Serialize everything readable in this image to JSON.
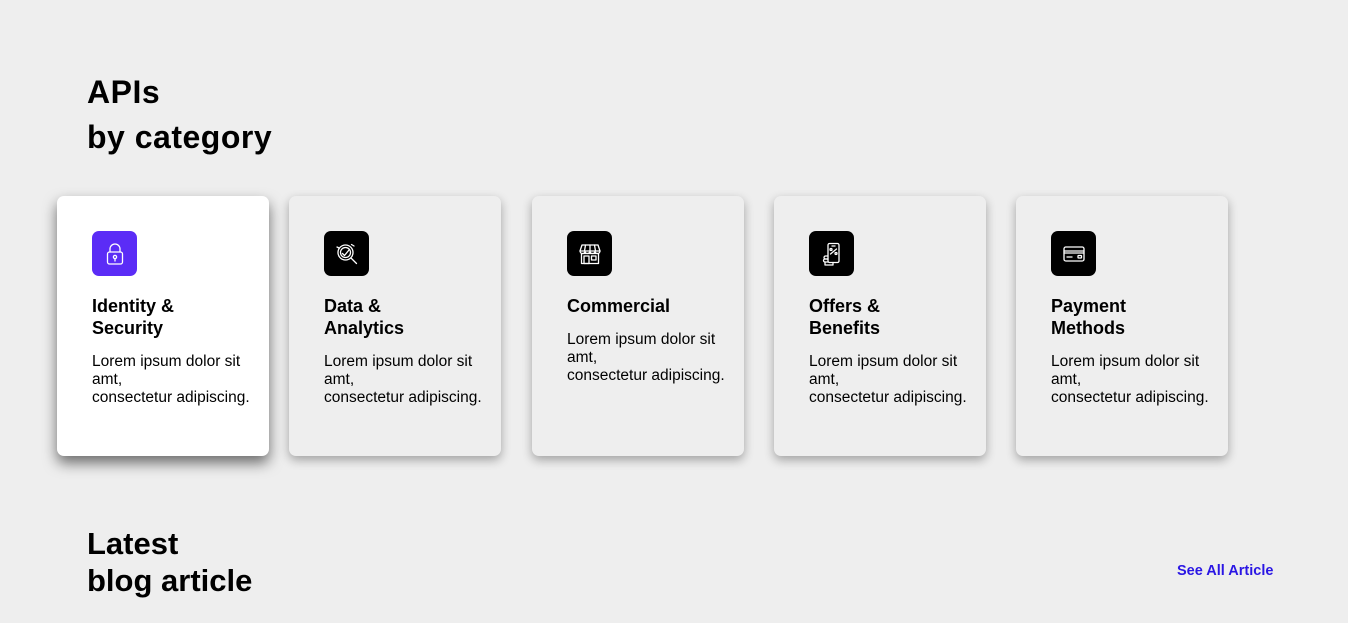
{
  "apis_section": {
    "title_line1": "APIs",
    "title_line2": "by category"
  },
  "categories": [
    {
      "title_line1": "Identity &",
      "title_line2": "Security",
      "description": "Lorem ipsum dolor sit\namt,\nconsectetur adipiscing.",
      "icon": "lock-icon",
      "active": true
    },
    {
      "title_line1": "Data &",
      "title_line2": "Analytics",
      "description": "Lorem ipsum dolor sit\namt,\nconsectetur adipiscing.",
      "icon": "analytics-search-icon",
      "active": false
    },
    {
      "title_line1": "Commercial",
      "title_line2": "",
      "description": "Lorem ipsum dolor sit\namt,\nconsectetur adipiscing.",
      "icon": "storefront-icon",
      "active": false
    },
    {
      "title_line1": "Offers &",
      "title_line2": "Benefits",
      "description": "Lorem ipsum dolor sit\namt,\nconsectetur adipiscing.",
      "icon": "mobile-discount-icon",
      "active": false
    },
    {
      "title_line1": "Payment",
      "title_line2": "Methods",
      "description": "Lorem ipsum dolor sit\namt,\nconsectetur adipiscing.",
      "icon": "credit-card-icon",
      "active": false
    }
  ],
  "blog_section": {
    "title_line1": "Latest",
    "title_line2": "blog article",
    "see_all_label": "See All Article"
  },
  "colors": {
    "background": "#eeeeee",
    "active_card": "#ffffff",
    "active_icon_bg": "#5b2cf6",
    "icon_bg": "#000000",
    "link": "#2a16e4"
  }
}
